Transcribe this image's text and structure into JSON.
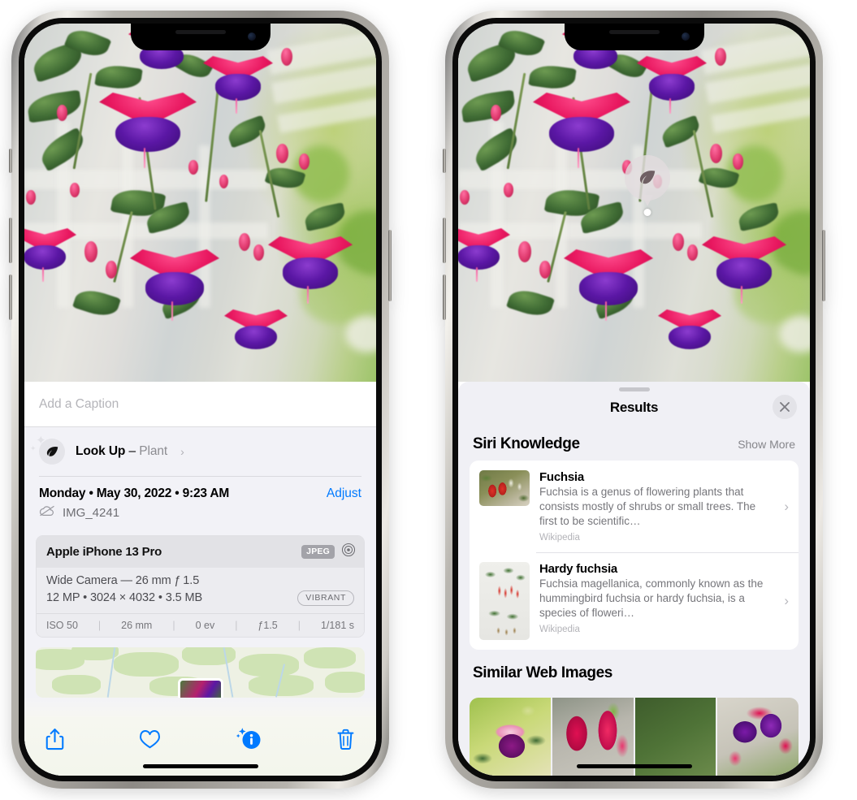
{
  "meta": {
    "device": "iPhone 13 Pro",
    "app": "Photos",
    "accent_blue": "#007aff",
    "sheet_bg": "#f2f2f7",
    "results_bg": "#f0f0f5"
  },
  "left_phone": {
    "caption": {
      "placeholder": "Add a Caption",
      "value": ""
    },
    "lookup": {
      "label_bold": "Look Up",
      "separator": " – ",
      "label_sub": "Plant",
      "chevron": "›",
      "icon": "leaf-icon"
    },
    "date_row": {
      "date_text": "Monday • May 30, 2022 • 9:23 AM",
      "adjust_label": "Adjust"
    },
    "file_row": {
      "icon": "cloud-slash-icon",
      "filename": "IMG_4241"
    },
    "exif": {
      "device": "Apple iPhone 13 Pro",
      "format_tag": "JPEG",
      "raw_icon": "aperture-icon",
      "lens_line": "Wide Camera — 26 mm ƒ 1.5",
      "size_line": "12 MP • 3024 × 4032 • 3.5 MB",
      "style_tag": "VIBRANT",
      "stats": [
        "ISO 50",
        "26 mm",
        "0 ev",
        "ƒ1.5",
        "1/181 s"
      ]
    },
    "toolbar": [
      {
        "name": "share-button",
        "icon": "share-icon"
      },
      {
        "name": "favorite-button",
        "icon": "heart-icon"
      },
      {
        "name": "info-button",
        "icon": "info-sparkle-icon"
      },
      {
        "name": "delete-button",
        "icon": "trash-icon"
      }
    ]
  },
  "right_phone": {
    "bubble": {
      "icon": "leaf-icon"
    },
    "sheet": {
      "title": "Results",
      "close_label": "✕"
    },
    "siri_knowledge": {
      "heading": "Siri Knowledge",
      "show_more": "Show More",
      "items": [
        {
          "title": "Fuchsia",
          "description": "Fuchsia is a genus of flowering plants that consists mostly of shrubs or small trees. The first to be scientific…",
          "source": "Wikipedia",
          "chevron": "›"
        },
        {
          "title": "Hardy fuchsia",
          "description": "Fuchsia magellanica, commonly known as the hummingbird fuchsia or hardy fuchsia, is a species of floweri…",
          "source": "Wikipedia",
          "chevron": "›"
        }
      ]
    },
    "similar_web_images": {
      "heading": "Similar Web Images",
      "tiles": [
        "fuchsia-thumb-1",
        "fuchsia-thumb-2",
        "fuchsia-thumb-3",
        "fuchsia-thumb-4"
      ]
    }
  }
}
